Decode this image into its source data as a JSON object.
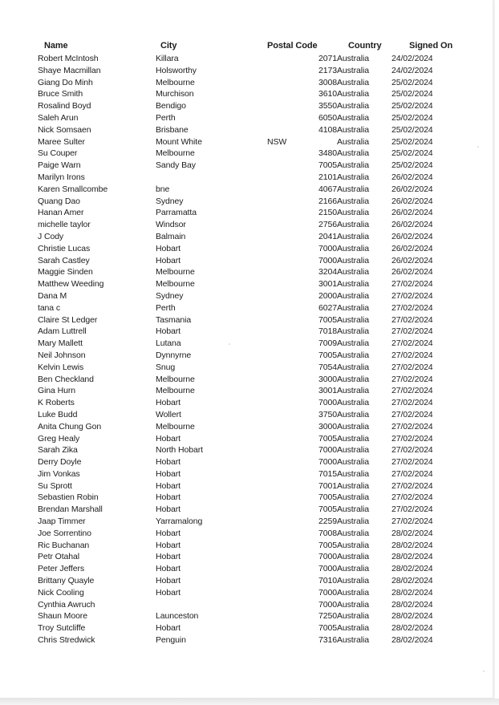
{
  "document": {
    "type": "scanned spreadsheet printout",
    "columns": [
      "Name",
      "City",
      "Postal Code",
      "Country",
      "Signed On"
    ],
    "rows": [
      {
        "name": "Robert McIntosh",
        "city": "Killara",
        "postal": "2071",
        "country": "Australia",
        "signed": "24/02/2024"
      },
      {
        "name": "Shaye Macmillan",
        "city": "Holsworthy",
        "postal": "2173",
        "country": "Australia",
        "signed": "24/02/2024"
      },
      {
        "name": "Giang Do Minh",
        "city": "Melbourne",
        "postal": "3008",
        "country": "Australia",
        "signed": "25/02/2024"
      },
      {
        "name": "Bruce Smith",
        "city": "Murchison",
        "postal": "3610",
        "country": "Australia",
        "signed": "25/02/2024"
      },
      {
        "name": "Rosalind Boyd",
        "city": "Bendigo",
        "postal": "3550",
        "country": "Australia",
        "signed": "25/02/2024"
      },
      {
        "name": "Saleh Arun",
        "city": "Perth",
        "postal": "6050",
        "country": "Australia",
        "signed": "25/02/2024"
      },
      {
        "name": "Nick Somsaen",
        "city": "Brisbane",
        "postal": "4108",
        "country": "Australia",
        "signed": "25/02/2024"
      },
      {
        "name": "Maree Sulter",
        "city": "Mount White",
        "postal": "NSW",
        "country": "Australia",
        "signed": "25/02/2024"
      },
      {
        "name": "Su Couper",
        "city": "Melbourne",
        "postal": "3480",
        "country": "Australia",
        "signed": "25/02/2024"
      },
      {
        "name": "Paige Warn",
        "city": "Sandy Bay",
        "postal": "7005",
        "country": "Australia",
        "signed": "25/02/2024"
      },
      {
        "name": "Marilyn Irons",
        "city": "",
        "postal": "2101",
        "country": "Australia",
        "signed": "26/02/2024"
      },
      {
        "name": "Karen Smallcombe",
        "city": "bne",
        "postal": "4067",
        "country": "Australia",
        "signed": "26/02/2024"
      },
      {
        "name": "Quang Dao",
        "city": "Sydney",
        "postal": "2166",
        "country": "Australia",
        "signed": "26/02/2024"
      },
      {
        "name": "Hanan Amer",
        "city": "Parramatta",
        "postal": "2150",
        "country": "Australia",
        "signed": "26/02/2024"
      },
      {
        "name": "michelle taylor",
        "city": "Windsor",
        "postal": "2756",
        "country": "Australia",
        "signed": "26/02/2024"
      },
      {
        "name": "J Cody",
        "city": "Balmain",
        "postal": "2041",
        "country": "Australia",
        "signed": "26/02/2024"
      },
      {
        "name": "Christie Lucas",
        "city": "Hobart",
        "postal": "7000",
        "country": "Australia",
        "signed": "26/02/2024"
      },
      {
        "name": "Sarah Castley",
        "city": "Hobart",
        "postal": "7000",
        "country": "Australia",
        "signed": "26/02/2024"
      },
      {
        "name": "Maggie Sinden",
        "city": "Melbourne",
        "postal": "3204",
        "country": "Australia",
        "signed": "26/02/2024"
      },
      {
        "name": "Matthew Weeding",
        "city": "Melbourne",
        "postal": "3001",
        "country": "Australia",
        "signed": "27/02/2024"
      },
      {
        "name": "Dana M",
        "city": "Sydney",
        "postal": "2000",
        "country": "Australia",
        "signed": "27/02/2024"
      },
      {
        "name": "tana c",
        "city": "Perth",
        "postal": "6027",
        "country": "Australia",
        "signed": "27/02/2024"
      },
      {
        "name": "Claire St Ledger",
        "city": "Tasmania",
        "postal": "7005",
        "country": "Australia",
        "signed": "27/02/2024"
      },
      {
        "name": "Adam Luttrell",
        "city": "Hobart",
        "postal": "7018",
        "country": "Australia",
        "signed": "27/02/2024"
      },
      {
        "name": "Mary Mallett",
        "city": "Lutana",
        "postal": "7009",
        "country": "Australia",
        "signed": "27/02/2024"
      },
      {
        "name": "Neil Johnson",
        "city": "Dynnyrne",
        "postal": "7005",
        "country": "Australia",
        "signed": "27/02/2024"
      },
      {
        "name": "Kelvin Lewis",
        "city": "Snug",
        "postal": "7054",
        "country": "Australia",
        "signed": "27/02/2024"
      },
      {
        "name": "Ben Checkland",
        "city": "Melbourne",
        "postal": "3000",
        "country": "Australia",
        "signed": "27/02/2024"
      },
      {
        "name": "Gina Hurn",
        "city": "Melbourne",
        "postal": "3001",
        "country": "Australia",
        "signed": "27/02/2024"
      },
      {
        "name": "K Roberts",
        "city": "Hobart",
        "postal": "7000",
        "country": "Australia",
        "signed": "27/02/2024"
      },
      {
        "name": "Luke Budd",
        "city": "Wollert",
        "postal": "3750",
        "country": "Australia",
        "signed": "27/02/2024"
      },
      {
        "name": "Anita Chung Gon",
        "city": "Melbourne",
        "postal": "3000",
        "country": "Australia",
        "signed": "27/02/2024"
      },
      {
        "name": "Greg Healy",
        "city": "Hobart",
        "postal": "7005",
        "country": "Australia",
        "signed": "27/02/2024"
      },
      {
        "name": "Sarah Zika",
        "city": "North Hobart",
        "postal": "7000",
        "country": "Australia",
        "signed": "27/02/2024"
      },
      {
        "name": "Derry Doyle",
        "city": "Hobart",
        "postal": "7000",
        "country": "Australia",
        "signed": "27/02/2024"
      },
      {
        "name": "Jim Vonkas",
        "city": "Hobart",
        "postal": "7015",
        "country": "Australia",
        "signed": "27/02/2024"
      },
      {
        "name": "Su Sprott",
        "city": "Hobart",
        "postal": "7001",
        "country": "Australia",
        "signed": "27/02/2024"
      },
      {
        "name": "Sebastien Robin",
        "city": "Hobart",
        "postal": "7005",
        "country": "Australia",
        "signed": "27/02/2024"
      },
      {
        "name": "Brendan Marshall",
        "city": "Hobart",
        "postal": "7005",
        "country": "Australia",
        "signed": "27/02/2024"
      },
      {
        "name": "Jaap Timmer",
        "city": "Yarramalong",
        "postal": "2259",
        "country": "Australia",
        "signed": "27/02/2024"
      },
      {
        "name": "Joe Sorrentino",
        "city": "Hobart",
        "postal": "7008",
        "country": "Australia",
        "signed": "28/02/2024"
      },
      {
        "name": "Ric Buchanan",
        "city": "Hobart",
        "postal": "7005",
        "country": "Australia",
        "signed": "28/02/2024"
      },
      {
        "name": "Petr Otahal",
        "city": "Hobart",
        "postal": "7000",
        "country": "Australia",
        "signed": "28/02/2024"
      },
      {
        "name": "Peter Jeffers",
        "city": "Hobart",
        "postal": "7000",
        "country": "Australia",
        "signed": "28/02/2024"
      },
      {
        "name": "Brittany Quayle",
        "city": "Hobart",
        "postal": "7010",
        "country": "Australia",
        "signed": "28/02/2024"
      },
      {
        "name": "Nick Cooling",
        "city": "Hobart",
        "postal": "7000",
        "country": "Australia",
        "signed": "28/02/2024"
      },
      {
        "name": "Cynthia Awruch",
        "city": "",
        "postal": "7000",
        "country": "Australia",
        "signed": "28/02/2024"
      },
      {
        "name": "Shaun Moore",
        "city": "Launceston",
        "postal": "7250",
        "country": "Australia",
        "signed": "28/02/2024"
      },
      {
        "name": "Troy Sutcliffe",
        "city": "Hobart",
        "postal": "7005",
        "country": "Australia",
        "signed": "28/02/2024"
      },
      {
        "name": "Chris Stredwick",
        "city": "Penguin",
        "postal": "7316",
        "country": "Australia",
        "signed": "28/02/2024"
      }
    ]
  }
}
